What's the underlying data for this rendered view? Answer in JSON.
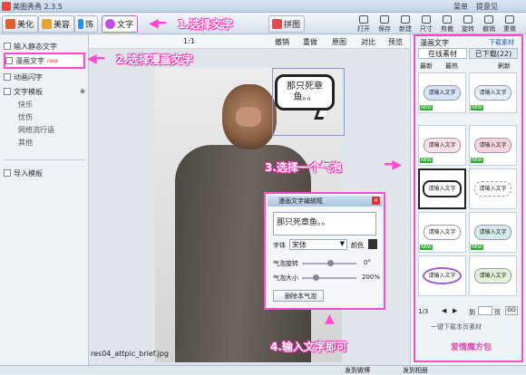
{
  "app": {
    "title": "美图秀秀 2.3.5"
  },
  "title_menu": {
    "menu": "菜单",
    "feedback": "提意见"
  },
  "tabs": [
    {
      "label": "美化",
      "color": "#e65d2b"
    },
    {
      "label": "美容",
      "color": "#e6a22b"
    },
    {
      "label": "饰",
      "color": "#2b8fe6"
    },
    {
      "label": "文字",
      "color": "#c44be0"
    },
    {
      "label": "拼图",
      "color": "#e64b4b"
    }
  ],
  "toolbar_right": [
    "打开",
    "保存",
    "新建",
    "尺寸",
    "剪裁",
    "旋转",
    "撤销",
    "重做"
  ],
  "canvas_toolbar": {
    "undo": "撤销",
    "redo": "重做",
    "original": "原图",
    "compare": "对比",
    "preview": "预览",
    "zoom": "1:1"
  },
  "left_panel": {
    "items": [
      "输入静态文字",
      "漫画文字",
      "动画闪字",
      "文字模板"
    ],
    "new_badge": "new",
    "template_subs": [
      "快乐",
      "忧伤",
      "网络流行语",
      "其他"
    ],
    "import": "导入模板"
  },
  "bubble_text": "那只死章鱼。。",
  "filename": "res04_attpic_brief.jpg",
  "editor": {
    "title": "漫画文字编辑框",
    "text": "那只死章鱼。。",
    "font_label": "字体",
    "font_value": "宋体",
    "color_label": "颜色",
    "rotate_label": "气泡旋转",
    "rotate_value": "0°",
    "size_label": "气泡大小",
    "size_value": "200%",
    "delete_label": "删除本气泡"
  },
  "right_panel": {
    "title": "漫画文字",
    "download_link": "下载素材",
    "tab_online": "在线素材",
    "tab_downloaded": "已下载(22)",
    "sort_new": "最新",
    "sort_hot": "最热",
    "refresh": "刷新",
    "thumb_text": "请输入文字",
    "new_badge": "NEW",
    "page": "1/3",
    "goto_label": "到",
    "page_suffix": "页",
    "go": "GO",
    "batch_download": "一键下载本页素材",
    "promo": "爱情魔方包"
  },
  "statusbar": {
    "weibo": "发到微博",
    "send": "发到相册"
  },
  "annotations": {
    "step1": "1.选择文字",
    "step2": "2.选择漫画文字",
    "step3": "3.选择一个气泡",
    "step4": "4.输入文字即可"
  },
  "colors": {
    "highlight": "#ff49d3"
  }
}
